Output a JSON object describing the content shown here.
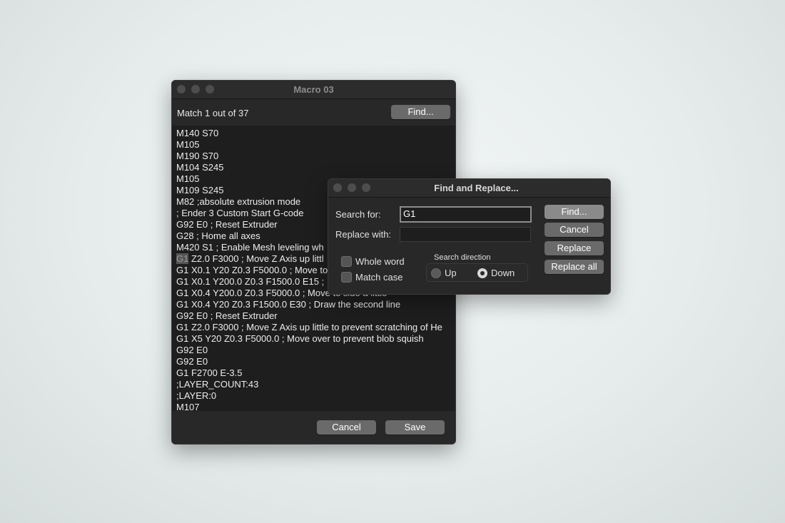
{
  "macro_window": {
    "title": "Macro 03",
    "match_status": "Match 1 out of 37",
    "find_button": "Find...",
    "highlight_term": "G1",
    "code_lines": [
      "M140 S70",
      "M105",
      "M190 S70",
      "M104 S245",
      "M105",
      "M109 S245",
      "M82 ;absolute extrusion mode",
      "; Ender 3 Custom Start G-code",
      "G92 E0 ; Reset Extruder",
      "G28 ; Home all axes",
      "M420 S1 ; Enable Mesh leveling wh",
      " Z2.0 F3000 ; Move Z Axis up littl",
      "G1 X0.1 Y20 Z0.3 F5000.0 ; Move to",
      "G1 X0.1 Y200.0 Z0.3 F1500.0 E15 ;",
      "G1 X0.4 Y200.0 Z0.3 F5000.0 ; Move to side a little",
      "G1 X0.4 Y20 Z0.3 F1500.0 E30 ; Draw the second line",
      "G92 E0 ; Reset Extruder",
      "G1 Z2.0 F3000 ; Move Z Axis up little to prevent scratching of He",
      "G1 X5 Y20 Z0.3 F5000.0 ; Move over to prevent blob squish",
      "G92 E0",
      "G92 E0",
      "G1 F2700 E-3.5",
      ";LAYER_COUNT:43",
      ";LAYER:0",
      "M107"
    ],
    "cancel_button": "Cancel",
    "save_button": "Save"
  },
  "find_window": {
    "title": "Find and Replace...",
    "search_label": "Search for:",
    "search_value": "G1",
    "replace_label": "Replace with:",
    "replace_value": "",
    "whole_word_label": "Whole word",
    "whole_word_checked": false,
    "match_case_label": "Match case",
    "match_case_checked": false,
    "direction_label": "Search direction",
    "direction_up": "Up",
    "direction_down": "Down",
    "direction_selected": "Down",
    "buttons": {
      "find": "Find...",
      "cancel": "Cancel",
      "replace": "Replace",
      "replace_all": "Replace all"
    }
  }
}
